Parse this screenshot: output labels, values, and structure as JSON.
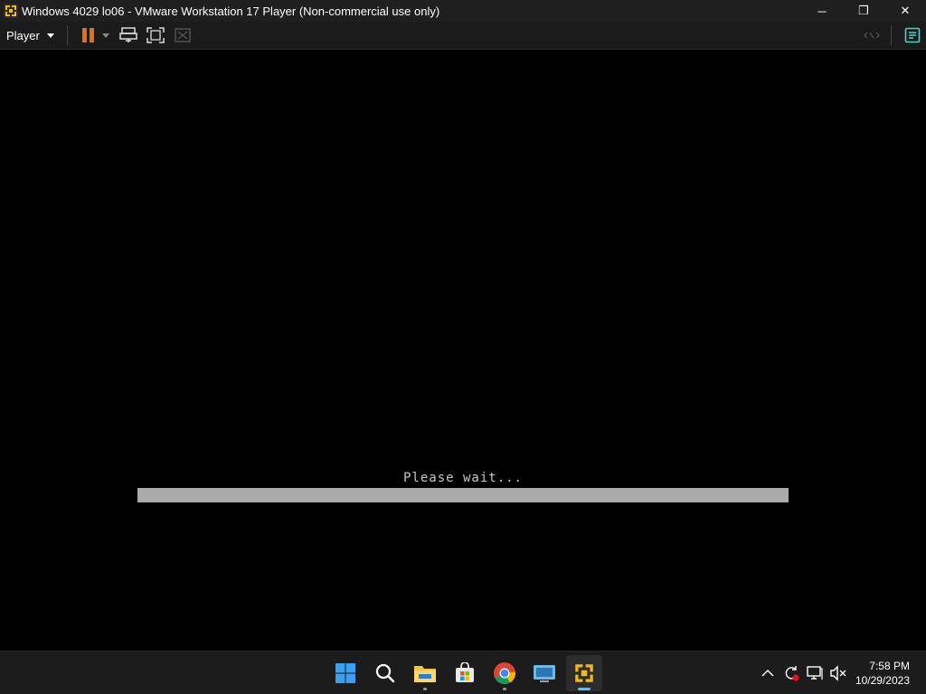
{
  "window": {
    "title": "Windows 4029 lo06 - VMware Workstation 17 Player (Non-commercial use only)",
    "app_icon": "vmware-icon",
    "controls": {
      "minimize": "─",
      "restore": "❐",
      "close": "✕"
    }
  },
  "toolbar": {
    "player_label": "Player",
    "buttons": [
      "pause-icon",
      "send-ctrl-alt-del-icon",
      "fullscreen-icon",
      "unity-icon"
    ],
    "right_buttons": [
      "unity-collapse-icon",
      "notes-icon"
    ]
  },
  "vm": {
    "message": "Please wait...",
    "progress": 1.0
  },
  "taskbar": {
    "apps": [
      "windows-start-icon",
      "search-icon",
      "file-explorer-icon",
      "microsoft-store-icon",
      "chrome-icon",
      "remote-desktop-icon",
      "vmware-icon"
    ],
    "active_app": "vmware-icon",
    "tray": [
      "chevron-up-icon",
      "sync-icon",
      "network-icon",
      "volume-muted-icon"
    ],
    "time": "7:58 PM",
    "date": "10/29/2023"
  },
  "colors": {
    "accent_orange": "#e0701f",
    "progress_fill": "#ababab",
    "taskbar_active": "#4cc2ff"
  }
}
